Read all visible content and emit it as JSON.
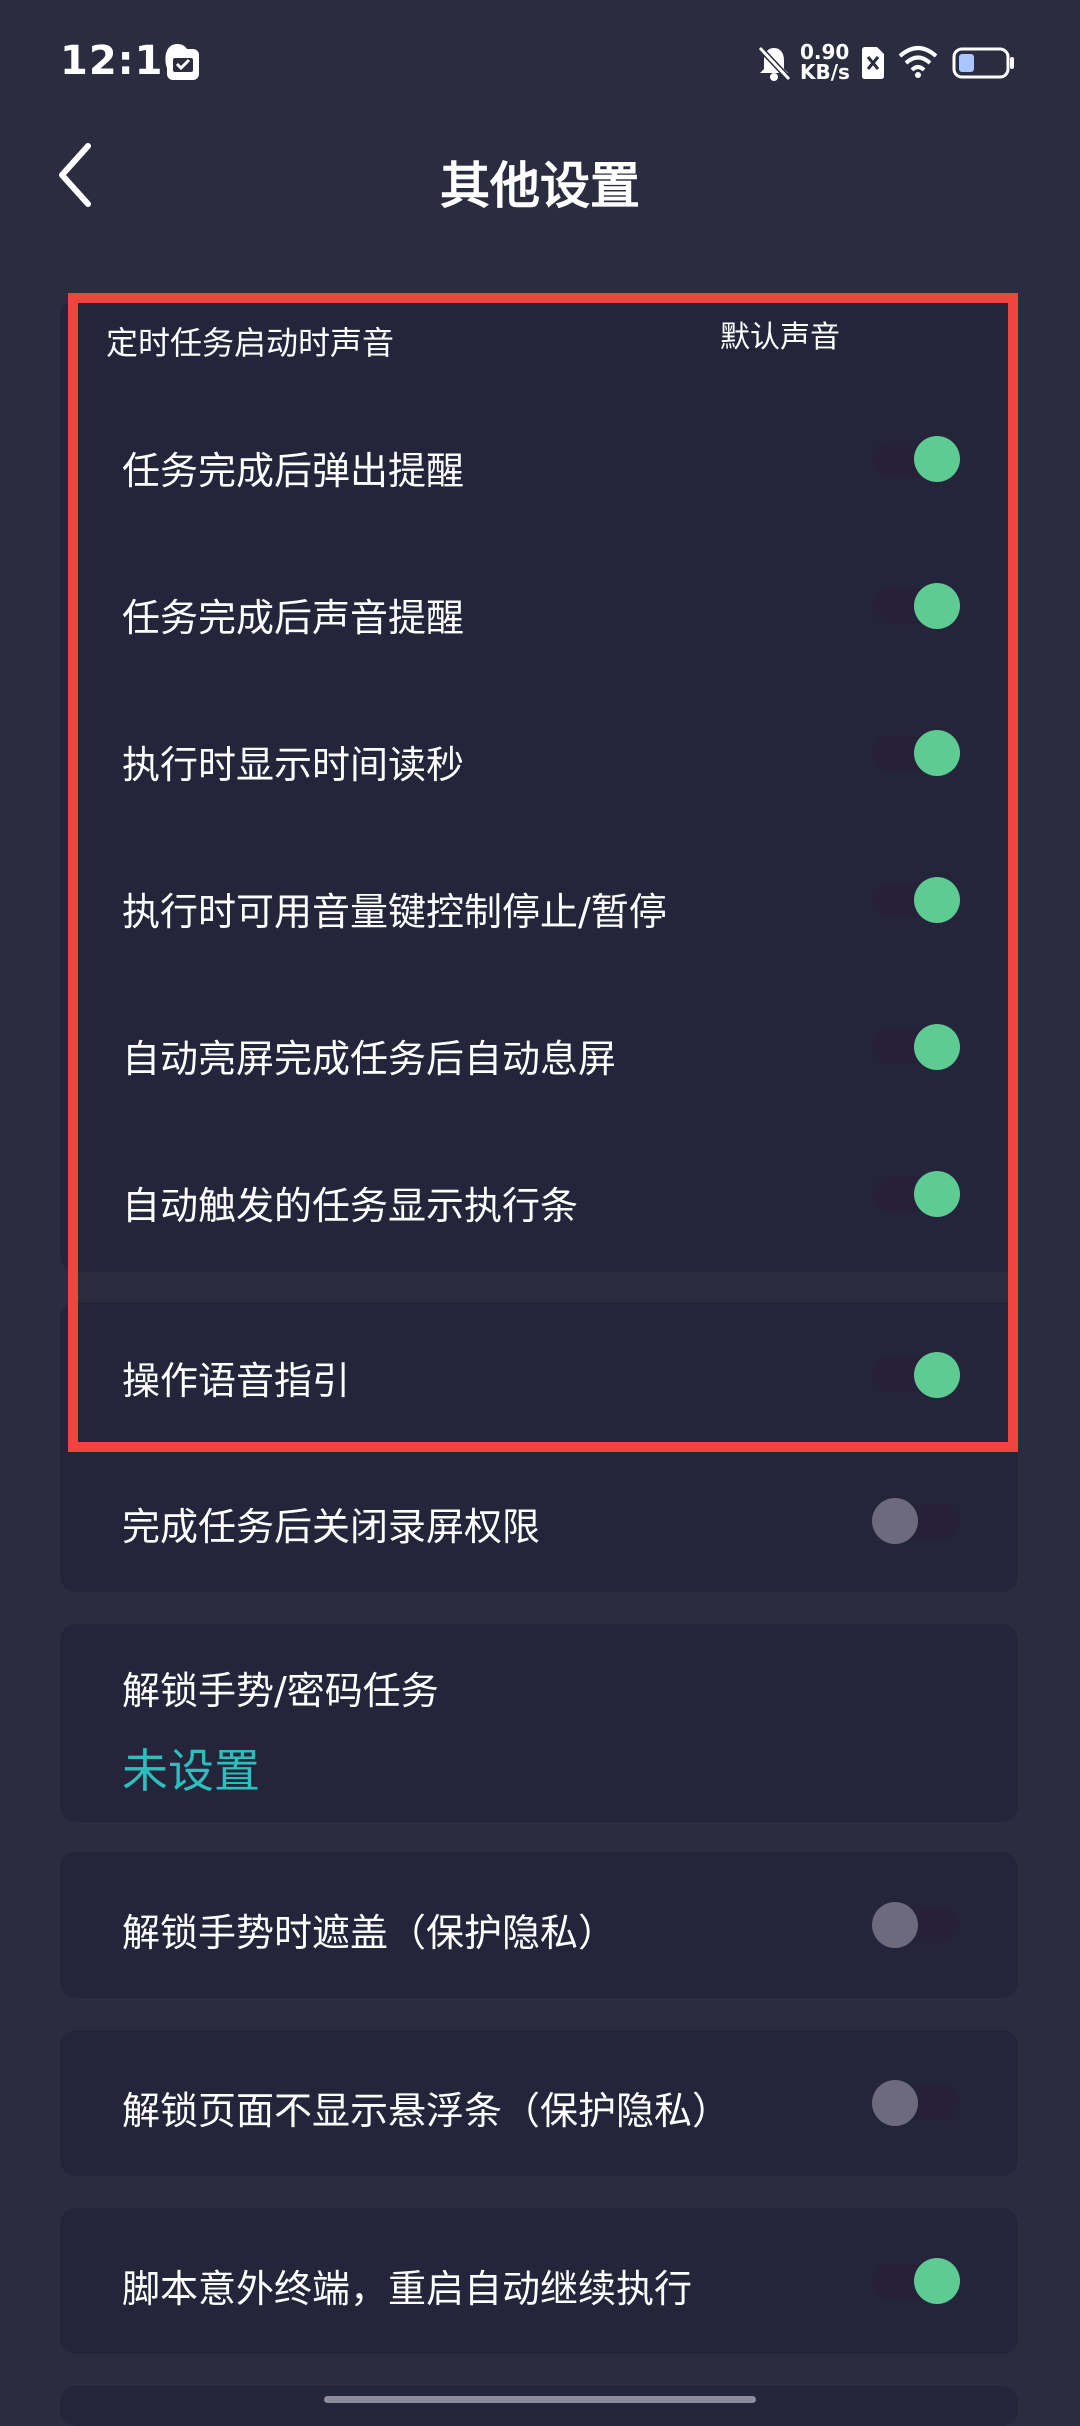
{
  "status_bar": {
    "time": "12:10",
    "net_speed_value": "0.90",
    "net_speed_unit": "KB/s",
    "icons": [
      "calendar-icon",
      "bell-off-icon",
      "sim-off-icon",
      "wifi-icon",
      "battery-icon"
    ],
    "battery_level": 0.35
  },
  "header": {
    "title": "其他设置",
    "back_icon": "chevron-left-icon"
  },
  "timed_task_sound": {
    "label": "定时任务启动时声音",
    "value": "默认声音"
  },
  "settings": [
    {
      "label": "任务完成后弹出提醒",
      "on": true
    },
    {
      "label": "任务完成后声音提醒",
      "on": true
    },
    {
      "label": "执行时显示时间读秒",
      "on": true
    },
    {
      "label": "执行时可用音量键控制停止/暂停",
      "on": true
    },
    {
      "label": "自动亮屏完成任务后自动息屏",
      "on": true
    },
    {
      "label": "自动触发的任务显示执行条",
      "on": true
    },
    {
      "label": "操作语音指引",
      "on": true
    },
    {
      "label": "完成任务后关闭录屏权限",
      "on": false
    }
  ],
  "unlock_task": {
    "label": "解锁手势/密码任务",
    "value": "未设置"
  },
  "more_settings": [
    {
      "label": "解锁手势时遮盖（保护隐私）",
      "on": false
    },
    {
      "label": "解锁页面不显示悬浮条（保护隐私）",
      "on": false
    },
    {
      "label": "脚本意外终端，重启自动继续执行",
      "on": true
    }
  ],
  "colors": {
    "background": "#2c2c41",
    "card": "#24243a",
    "toggle_on": "#5dcb92",
    "toggle_off": "#6e6a7d",
    "accent_text": "#2dbfbe",
    "highlight": "#f0443f"
  }
}
